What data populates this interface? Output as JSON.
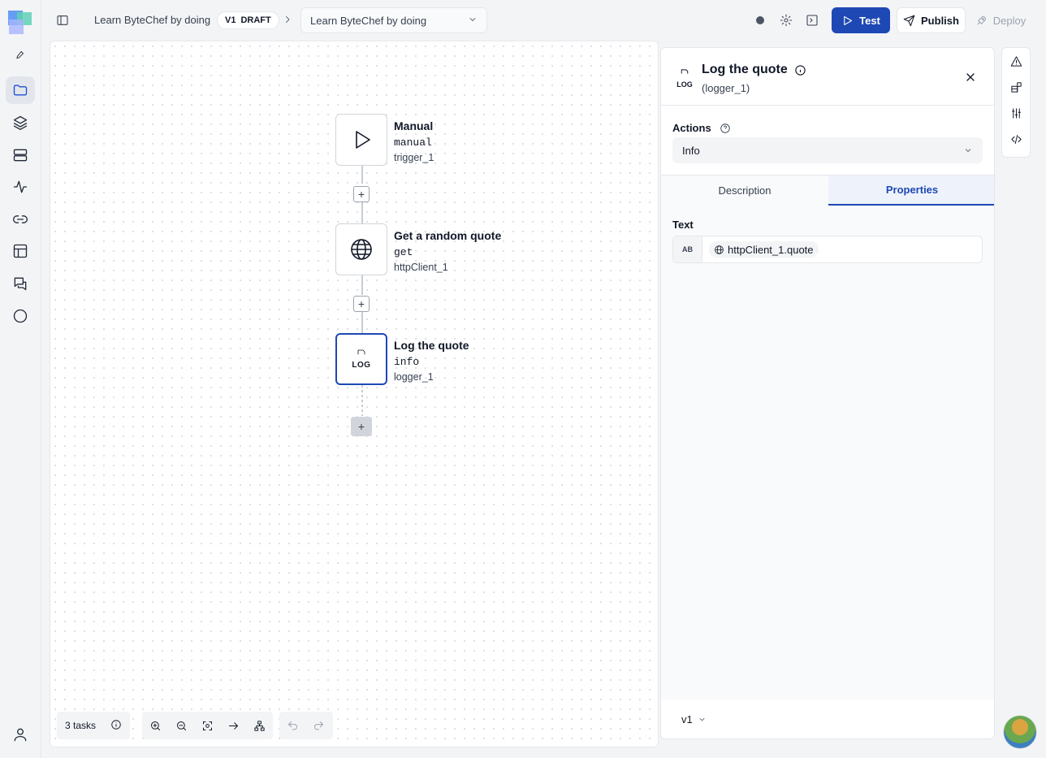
{
  "header": {
    "breadcrumb_project": "Learn ByteChef by doing",
    "version_label": "V1",
    "version_status": "DRAFT",
    "workflow_select": "Learn ByteChef by doing",
    "test_label": "Test",
    "publish_label": "Publish",
    "deploy_label": "Deploy"
  },
  "workflow": {
    "nodes": [
      {
        "title": "Manual",
        "operation": "manual",
        "id": "trigger_1",
        "icon": "play-icon"
      },
      {
        "title": "Get a random quote",
        "operation": "get",
        "id": "httpClient_1",
        "icon": "globe-icon"
      },
      {
        "title": "Log the quote",
        "operation": "info",
        "id": "logger_1",
        "icon": "log-icon",
        "log_text": "LOG"
      }
    ]
  },
  "toolbar": {
    "tasks_label": "3 tasks"
  },
  "panel": {
    "title": "Log the quote",
    "subtitle": "(logger_1)",
    "icon_text": "LOG",
    "actions_label": "Actions",
    "action_value": "Info",
    "tabs": [
      "Description",
      "Properties"
    ],
    "active_tab": "Properties",
    "text_label": "Text",
    "text_type_badge": "AB",
    "text_value": "httpClient_1.quote",
    "version": "v1"
  },
  "colors": {
    "accent": "#1e48b4",
    "selected_border": "#1e48b4"
  }
}
